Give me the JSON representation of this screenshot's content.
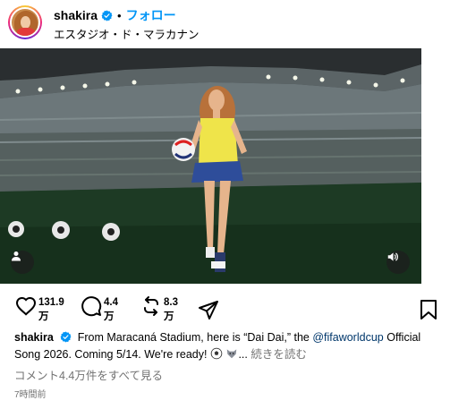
{
  "header": {
    "username": "shakira",
    "separator": "•",
    "follow_label": "フォロー",
    "location": "エスタジオ・ド・マラカナン"
  },
  "colors": {
    "accent": "#0095f6",
    "mention": "#00376b",
    "muted": "#737373",
    "verified": "#0095f6"
  },
  "actions": {
    "like_count_num": "131.9",
    "like_count_unit": "万",
    "comment_count_num": "4.4",
    "comment_count_unit": "万",
    "repost_count_num": "8.3",
    "repost_count_unit": "万",
    "icons": [
      "heart-icon",
      "comment-icon",
      "repost-icon",
      "share-icon",
      "bookmark-icon"
    ]
  },
  "caption": {
    "username": "shakira",
    "text_before_mention": "From Maracaná Stadium, here is “Dai Dai,” the ",
    "mention": "@fifaworldcup",
    "text_after_mention": "Official Song 2026. Coming 5/14. We're ready! ",
    "ellipsis": "...",
    "more_label": "続きを読む"
  },
  "comments_link": "コメント4.4万件をすべて見る",
  "timestamp": "7時間前",
  "media_icons": [
    "user-tag-icon",
    "sound-icon"
  ]
}
